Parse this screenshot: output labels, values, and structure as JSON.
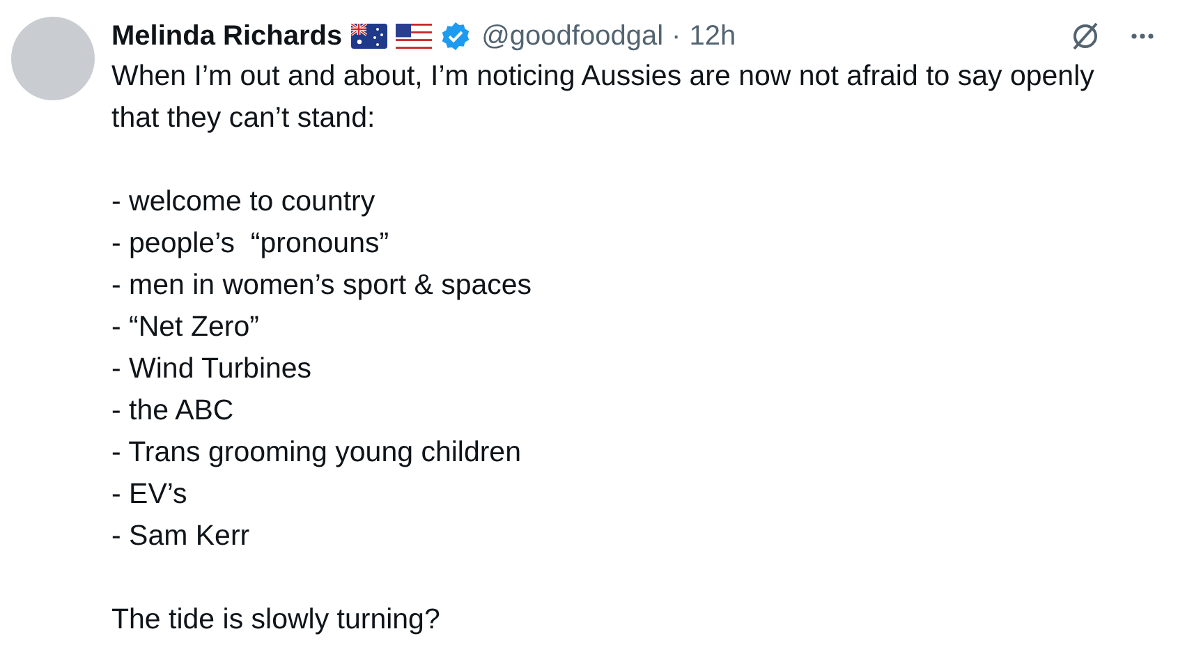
{
  "post": {
    "author": {
      "name": "Melinda Richards",
      "handle": "@goodfoodgal",
      "separator": "·",
      "time": "12h",
      "verified": true
    },
    "intro": "When I’m out and about, I’m noticing Aussies are now not afraid to say openly that they can’t stand:",
    "items": [
      "- welcome to country",
      "- people’s  “pronouns”",
      "- men in women’s sport & spaces",
      "- “Net Zero”",
      "- Wind Turbines",
      "- the ABC",
      "- Trans grooming young children",
      "- EV’s",
      "- Sam Kerr"
    ],
    "closing": "The tide is slowly turning?"
  }
}
